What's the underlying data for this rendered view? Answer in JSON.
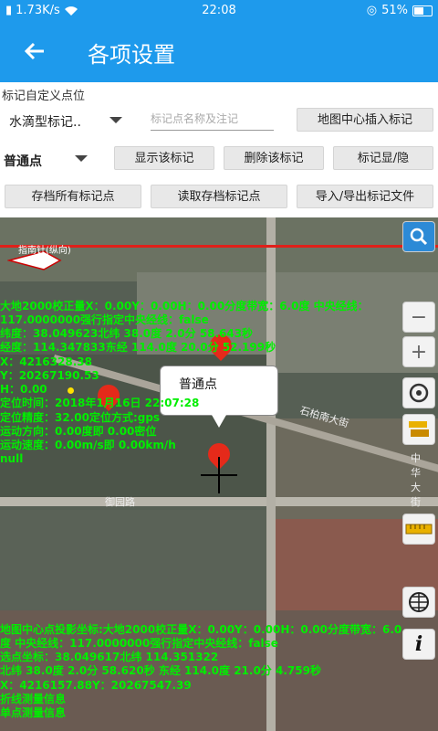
{
  "status_bar": {
    "net_speed": "1.73K/s",
    "time": "22:08",
    "battery": "51%"
  },
  "app_bar": {
    "title": "各项设置"
  },
  "marker_panel": {
    "section_label": "标记自定义点位",
    "marker_type": "水滴型标记..",
    "name_input_placeholder": "标记点名称及注记",
    "insert_center_button": "地图中心插入标记",
    "point_type": "普通点",
    "show_button": "显示该标记",
    "delete_button": "删除该标记",
    "toggle_button": "标记显/隐",
    "save_all_button": "存档所有标记点",
    "read_button": "读取存档标记点",
    "import_export_button": "导入/导出标记文件"
  },
  "map": {
    "scale_text": "指南针(纵向)",
    "road_labels": [
      "石柏南大街",
      "御园路",
      "中华大街"
    ],
    "popup_label": "普通点",
    "info_lines": [
      "大地2000校正量X：0.00Y：0.00H：0.00分度带宽：6.0度 中央经线：",
      "117.0000000强行指定中央经线：false",
      "纬度：38.049623北纬 38.0度 2.0分 58.643秒",
      "经度：114.347833东经 114.0度 20.0分 52.199秒",
      "X：4216328.38",
      "Y：20267190.53",
      "H：0.00",
      "定位时间：2018年1月16日 22:07:28",
      "定位精度：32.00定位方式:gps",
      "运动方向：0.00度即 0.00密位",
      "运动速度：0.00m/s即 0.00km/h",
      "null"
    ],
    "bottom_lines": [
      "地图中心点投影坐标:大地2000校正量X：0.00Y：0.00H：0.00分度带宽：6.0",
      "度 中央经线：117.0000000强行指定中央经线：false",
      "选点坐标：38.049617北纬 114.351322",
      "北纬 38.0度 2.0分 58.620秒 东经 114.0度 21.0分 4.759秒",
      "X：4216157.88Y：20267547.39",
      "折线测量信息",
      "单点测量信息"
    ]
  },
  "colors": {
    "primary": "#1e9aec",
    "overlay_text": "#00ee00",
    "marker": "#e52a1a"
  }
}
